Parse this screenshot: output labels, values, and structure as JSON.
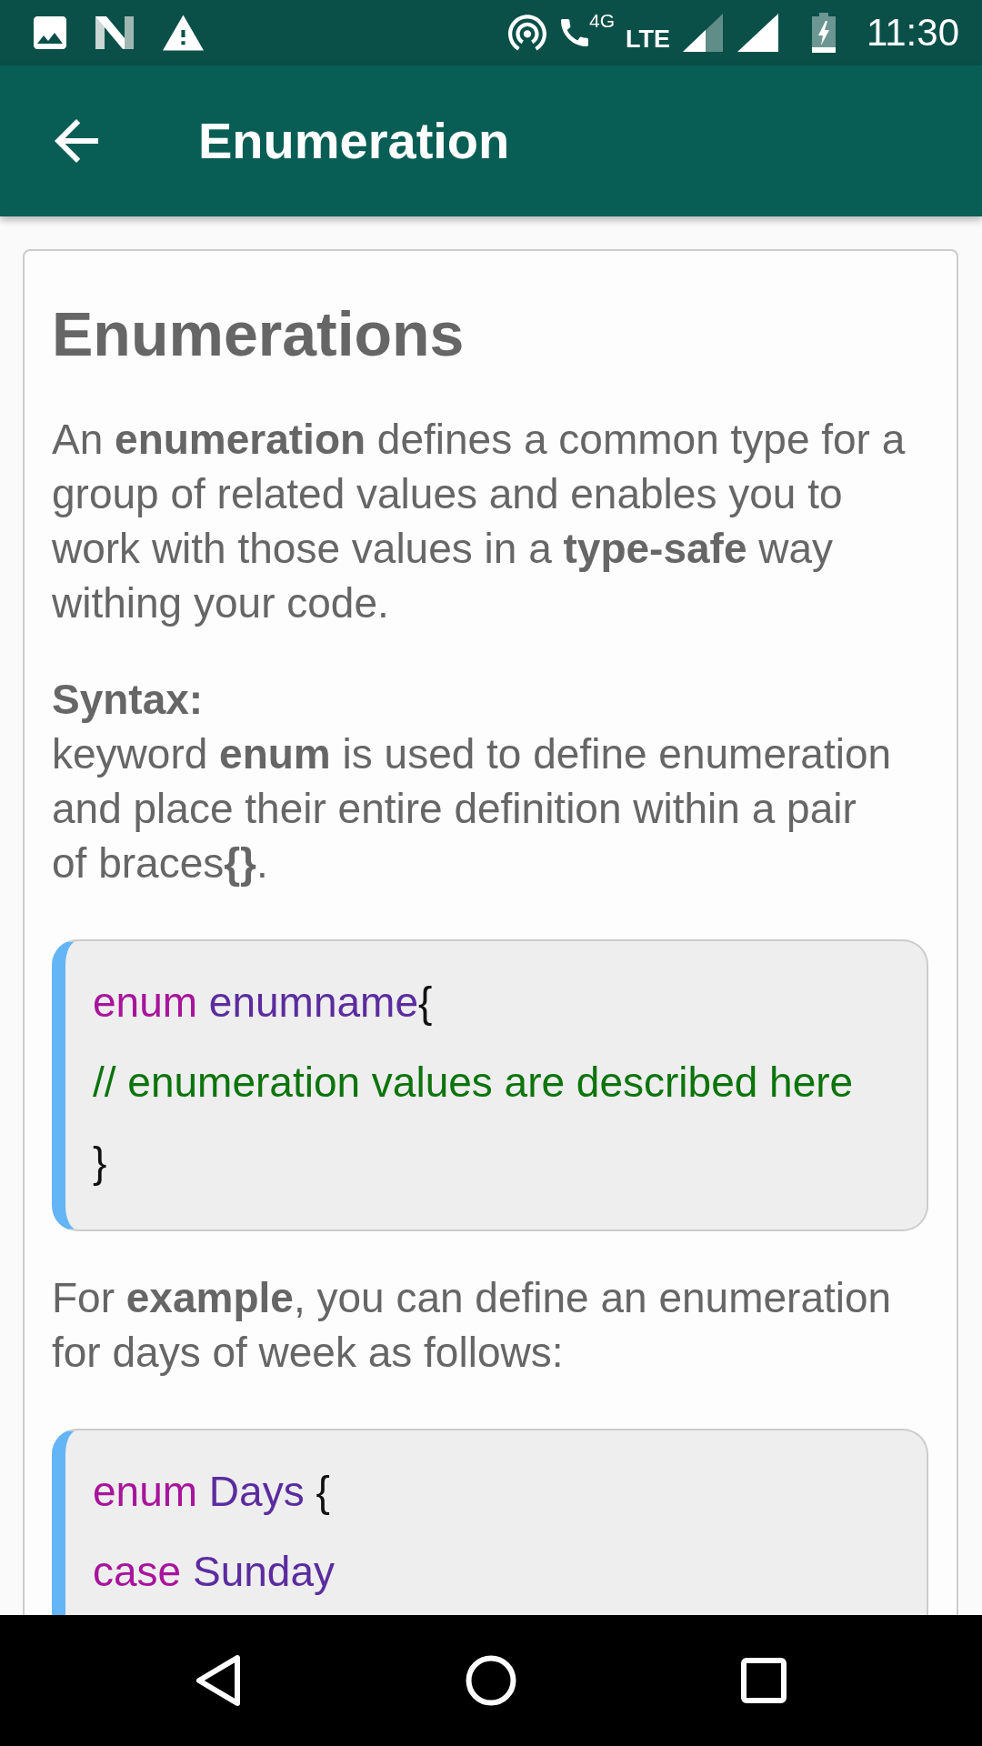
{
  "status_bar": {
    "network_generation": "4G",
    "network_type": "LTE",
    "time": "11:30"
  },
  "app_bar": {
    "title": "Enumeration"
  },
  "article": {
    "heading": "Enumerations",
    "blocks": [
      {
        "kind": "paragraph",
        "text": "An **enumeration** defines a common type for a group of related values and enables you to work with those values in a **type-safe** way withing your code."
      },
      {
        "kind": "definition",
        "label": "Syntax:",
        "text": "keyword **enum** is used to define enumeration and place their entire definition within a pair of braces**{}**."
      },
      {
        "kind": "code",
        "lines": [
          {
            "tokens": [
              {
                "kind": "keyword",
                "text": "enum"
              },
              {
                "kind": "name",
                "text": " enumname"
              },
              {
                "kind": "punctuation",
                "text": "{"
              }
            ]
          },
          {
            "tokens": [
              {
                "kind": "comment",
                "text": "// enumeration values are described here"
              }
            ]
          },
          {
            "tokens": [
              {
                "kind": "punctuation",
                "text": "}"
              }
            ]
          }
        ]
      },
      {
        "kind": "paragraph",
        "text": "For **example**, you can define an enumeration for days of week as follows:"
      },
      {
        "kind": "code",
        "lines": [
          {
            "tokens": [
              {
                "kind": "keyword",
                "text": "enum"
              },
              {
                "kind": "name",
                "text": " Days"
              },
              {
                "kind": "punctuation",
                "text": " {"
              }
            ]
          },
          {
            "tokens": [
              {
                "kind": "keyword",
                "text": "case"
              },
              {
                "kind": "name",
                "text": " Sunday"
              }
            ]
          }
        ]
      }
    ]
  }
}
